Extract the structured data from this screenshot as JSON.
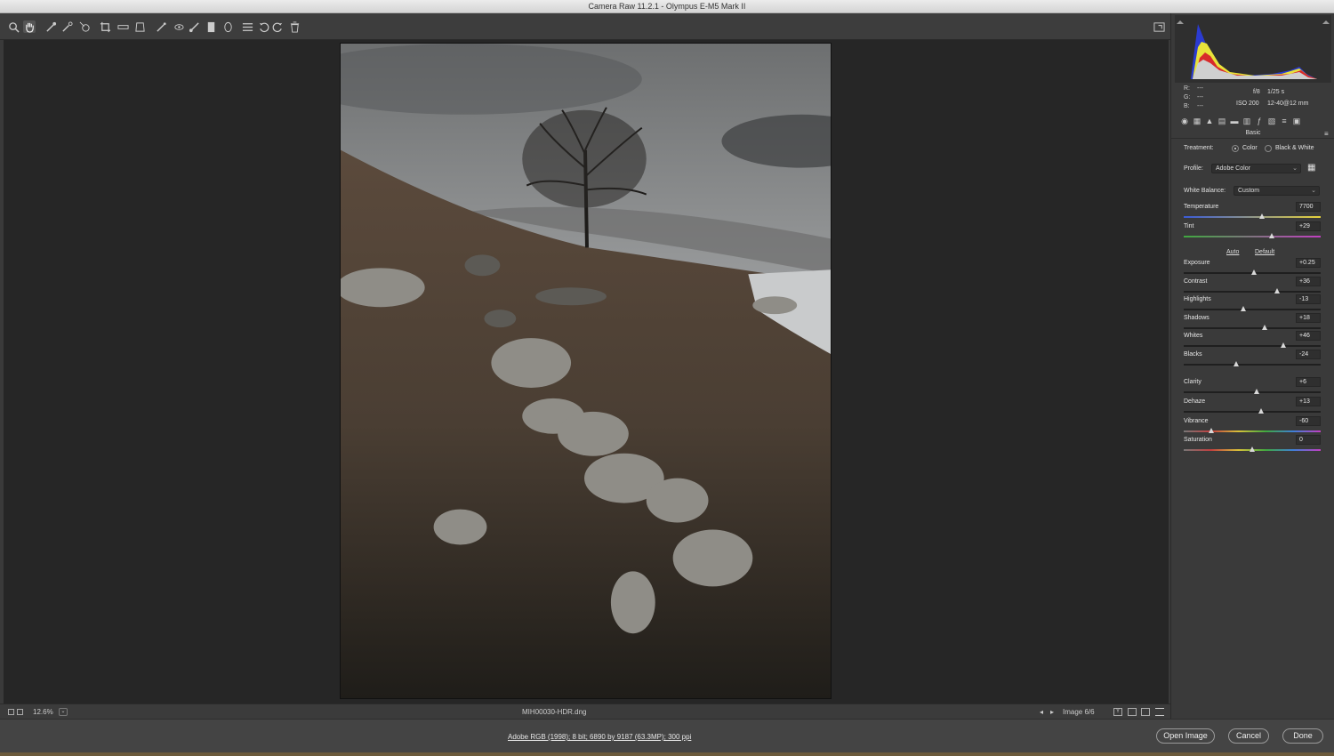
{
  "window": {
    "title": "Camera Raw 11.2.1  -  Olympus E-M5 Mark II"
  },
  "toolbar": {
    "tools": [
      "zoom-icon",
      "hand-icon",
      "white-balance-icon",
      "color-sampler-icon",
      "targeted-adjustment-icon",
      "crop-icon",
      "straighten-icon",
      "transform-icon",
      "spot-removal-icon",
      "red-eye-icon",
      "adjustment-brush-icon",
      "graduated-filter-icon",
      "radial-filter-icon",
      "presets-list-icon",
      "rotate-left-icon",
      "rotate-right-icon",
      "trash-icon"
    ],
    "fullscreen_icon": "fullscreen-toggle-icon"
  },
  "status": {
    "zoom": "12.6%",
    "filename": "MIH00030-HDR.dng",
    "image_counter": "Image 6/6"
  },
  "bottom": {
    "workflow_link": "Adobe RGB (1998); 8 bit; 6890 by 9187 (63.3MP); 300 ppi",
    "open_image": "Open Image",
    "cancel": "Cancel",
    "done": "Done"
  },
  "histogram": {
    "r": "R:",
    "g": "G:",
    "b": "B:",
    "r_val": "---",
    "g_val": "---",
    "b_val": "---",
    "aperture": "f/8",
    "shutter": "1/25 s",
    "iso": "ISO 200",
    "lens": "12-40@12 mm"
  },
  "panel": {
    "section": "Basic",
    "treatment_label": "Treatment:",
    "treatment_color": "Color",
    "treatment_bw": "Black & White",
    "treatment_selected": "Color",
    "profile_label": "Profile:",
    "profile_value": "Adobe Color",
    "wb_label": "White Balance:",
    "wb_value": "Custom",
    "auto": "Auto",
    "default": "Default",
    "sliders": [
      {
        "name": "Temperature",
        "value": "7700",
        "pos": 0.57
      },
      {
        "name": "Tint",
        "value": "+29",
        "pos": 0.645
      },
      {
        "name": "Exposure",
        "value": "+0.25",
        "pos": 0.515
      },
      {
        "name": "Contrast",
        "value": "+36",
        "pos": 0.68
      },
      {
        "name": "Highlights",
        "value": "-13",
        "pos": 0.435
      },
      {
        "name": "Shadows",
        "value": "+18",
        "pos": 0.59
      },
      {
        "name": "Whites",
        "value": "+46",
        "pos": 0.73
      },
      {
        "name": "Blacks",
        "value": "-24",
        "pos": 0.38
      },
      {
        "name": "Clarity",
        "value": "+6",
        "pos": 0.53
      },
      {
        "name": "Dehaze",
        "value": "+13",
        "pos": 0.565
      },
      {
        "name": "Vibrance",
        "value": "-60",
        "pos": 0.2
      },
      {
        "name": "Saturation",
        "value": "0",
        "pos": 0.5
      }
    ]
  },
  "colors": {
    "temperature_track": [
      "#3a5bd8",
      "#e6d23a"
    ],
    "tint_track": [
      "#3fa83f",
      "#c23fc2"
    ],
    "vibrance_track": [
      "#777777",
      "#c23f3f"
    ]
  }
}
